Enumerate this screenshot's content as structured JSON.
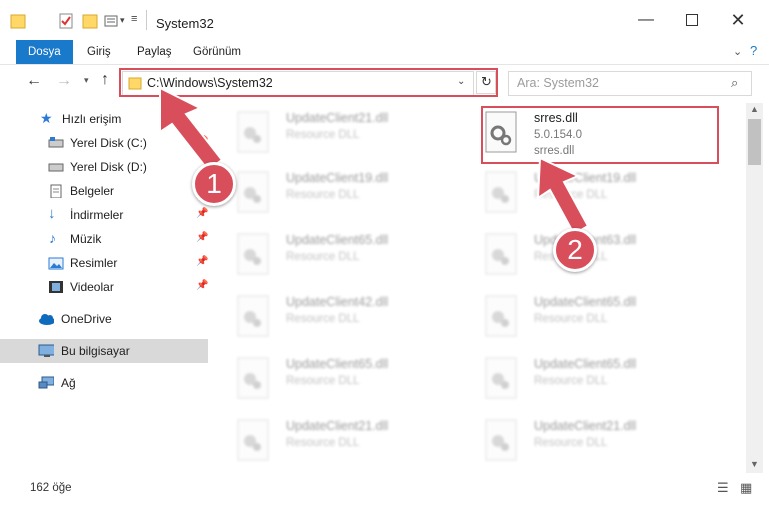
{
  "window": {
    "title": "System32"
  },
  "ribbon": {
    "tabs": [
      "Dosya",
      "Giriş",
      "Paylaş",
      "Görünüm"
    ]
  },
  "address": {
    "path": "C:\\Windows\\System32"
  },
  "search": {
    "placeholder": "Ara: System32"
  },
  "sidebar": {
    "items": [
      {
        "label": "Hızlı erişim",
        "icon": "star-icon"
      },
      {
        "label": "Yerel Disk (C:)",
        "icon": "drive-icon"
      },
      {
        "label": "Yerel Disk (D:)",
        "icon": "drive-icon"
      },
      {
        "label": "Belgeler",
        "icon": "documents-icon"
      },
      {
        "label": "İndirmeler",
        "icon": "download-icon"
      },
      {
        "label": "Müzik",
        "icon": "music-icon"
      },
      {
        "label": "Resimler",
        "icon": "pictures-icon"
      },
      {
        "label": "Videolar",
        "icon": "video-icon"
      },
      {
        "label": "OneDrive",
        "icon": "cloud-icon"
      },
      {
        "label": "Bu bilgisayar",
        "icon": "computer-icon"
      },
      {
        "label": "Ağ",
        "icon": "network-icon"
      }
    ]
  },
  "files": {
    "highlight": {
      "name": "srres.dll",
      "version": "5.0.154.0",
      "desc": "srres.dll"
    },
    "left": [
      {
        "name": "UpdateClient21.dll",
        "desc": "Resource DLL"
      },
      {
        "name": "UpdateClient19.dll",
        "desc": "Resource DLL"
      },
      {
        "name": "UpdateClient65.dll",
        "desc": "Resource DLL"
      },
      {
        "name": "UpdateClient42.dll",
        "desc": "Resource DLL"
      },
      {
        "name": "UpdateClient65.dll",
        "desc": "Resource DLL"
      },
      {
        "name": "UpdateClient21.dll",
        "desc": "Resource DLL"
      }
    ],
    "right": [
      {
        "name": "UpdateClient19.dll",
        "desc": "Resource DLL"
      },
      {
        "name": "UpdateClient63.dll",
        "desc": "Resource DLL"
      },
      {
        "name": "UpdateClient65.dll",
        "desc": "Resource DLL"
      },
      {
        "name": "UpdateClient65.dll",
        "desc": "Resource DLL"
      },
      {
        "name": "UpdateClient21.dll",
        "desc": "Resource DLL"
      }
    ]
  },
  "status": {
    "count": "162 öğe"
  },
  "annotations": {
    "step1": "1",
    "step2": "2"
  },
  "colors": {
    "accent": "#1979ca",
    "highlight": "#d94e5b"
  }
}
